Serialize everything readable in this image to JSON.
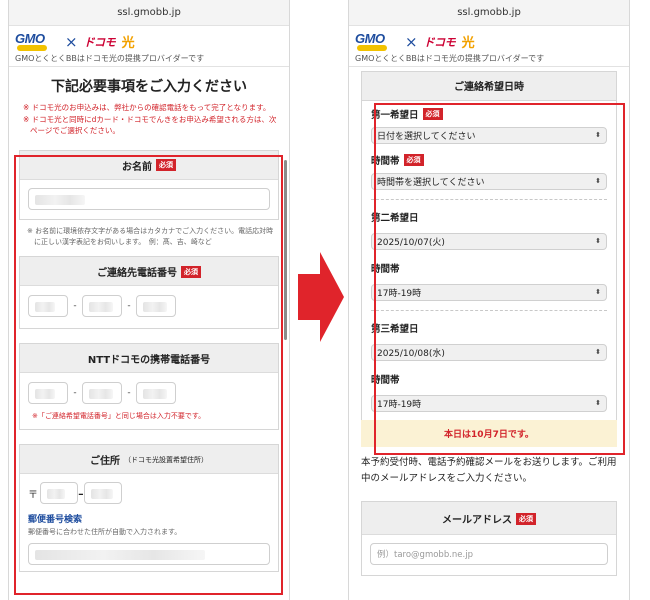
{
  "left": {
    "url": "ssl.gmobb.jp",
    "brand": {
      "gmo": "GMO",
      "cross": "×",
      "docomo": "ドコモ",
      "hikari": "光",
      "tagline": "GMOとくとくBBはドコモ光の提携プロバイダーです"
    },
    "page_title": "下記必要事項をご入力ください",
    "notices": [
      "※ ドコモ光のお申込みは、弊社からの確認電話をもって完了となります。",
      "※ ドコモ光と同時にdカード・ドコモでんきをお申込み希望される方は、次ページでご選択ください。"
    ],
    "name_card": {
      "title": "お名前",
      "badge": "必須"
    },
    "name_hint": "※ お名前に環境依存文字がある場合はカタカナでご入力ください。電話応対時に正しい漢字表記をお伺いします。　例：髙、吉、崎など",
    "contact_card": {
      "title": "ご連絡先電話番号",
      "badge": "必須",
      "dash": "-"
    },
    "ntt_card": {
      "title": "NTTドコモの携帯電話番号",
      "dash": "-",
      "warning": "※「ご連絡希望電話番号」と同じ場合は入力不要です。"
    },
    "address_card": {
      "title": "ご住所",
      "subtitle": "（ドコモ光設置希望住所）",
      "postal_mark": "〒",
      "dash": "-",
      "zip_link": "郵便番号検索",
      "zip_sub": "郵便番号に合わせた住所が自動で入力されます。"
    }
  },
  "right": {
    "url": "ssl.gmobb.jp",
    "brand": {
      "gmo": "GMO",
      "cross": "×",
      "docomo": "ドコモ",
      "hikari": "光",
      "tagline": "GMOとくとくBBはドコモ光の提携プロバイダーです"
    },
    "section_title": "ご連絡希望日時",
    "slots": [
      {
        "date_label": "第一希望日",
        "badge": "必須",
        "date_value": "日付を選択してください",
        "time_label": "時間帯",
        "time_badge": "必須",
        "time_value": "時間帯を選択してください"
      },
      {
        "date_label": "第二希望日",
        "badge": "",
        "date_value": "2025/10/07(火)",
        "time_label": "時間帯",
        "time_badge": "",
        "time_value": "17時-19時"
      },
      {
        "date_label": "第三希望日",
        "badge": "",
        "date_value": "2025/10/08(水)",
        "time_label": "時間帯",
        "time_badge": "",
        "time_value": "17時-19時"
      }
    ],
    "today_notice": "本日は10月7日です。",
    "description": "本予約受付時、電話予約確認メールをお送りします。ご利用中のメールアドレスをご入力ください。",
    "mail_card": {
      "title": "メールアドレス",
      "badge": "必須",
      "placeholder": "例）taro@gmobb.ne.jp"
    }
  },
  "colors": {
    "accent_red": "#e0242b",
    "brand_blue": "#1d4c9e",
    "notice_bg": "#fbf2d4"
  },
  "icons": [
    "chevron-updown-icon",
    "right-arrow-icon"
  ]
}
